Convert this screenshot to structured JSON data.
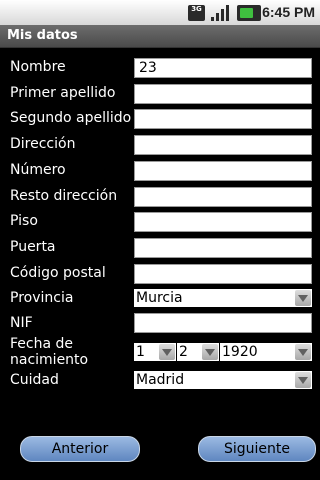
{
  "status_bar": {
    "network_icon": "3g-icon",
    "network_label": "3G",
    "signal_icon": "signal-bars-icon",
    "battery_icon": "battery-charging-icon",
    "time": "6:45 PM"
  },
  "title": "Mis datos",
  "form": {
    "nombre": {
      "label": "Nombre",
      "value": "23"
    },
    "primer_apellido": {
      "label": "Primer apellido",
      "value": ""
    },
    "segundo_apellido": {
      "label": "Segundo apellido",
      "value": ""
    },
    "direccion": {
      "label": "Dirección",
      "value": ""
    },
    "numero": {
      "label": "Número",
      "value": ""
    },
    "resto_direccion": {
      "label": "Resto dirección",
      "value": ""
    },
    "piso": {
      "label": "Piso",
      "value": ""
    },
    "puerta": {
      "label": "Puerta",
      "value": ""
    },
    "codigo_postal": {
      "label": "Código postal",
      "value": ""
    },
    "provincia": {
      "label": "Provincia",
      "selected": "Murcia"
    },
    "nif": {
      "label": "NIF",
      "value": ""
    },
    "fecha_nacimiento": {
      "label": "Fecha de nacimiento",
      "day": "1",
      "month": "2",
      "year": "1920"
    },
    "cuidad": {
      "label": "Cuidad",
      "selected": "Madrid"
    }
  },
  "buttons": {
    "anterior": "Anterior",
    "siguiente": "Siguiente"
  }
}
